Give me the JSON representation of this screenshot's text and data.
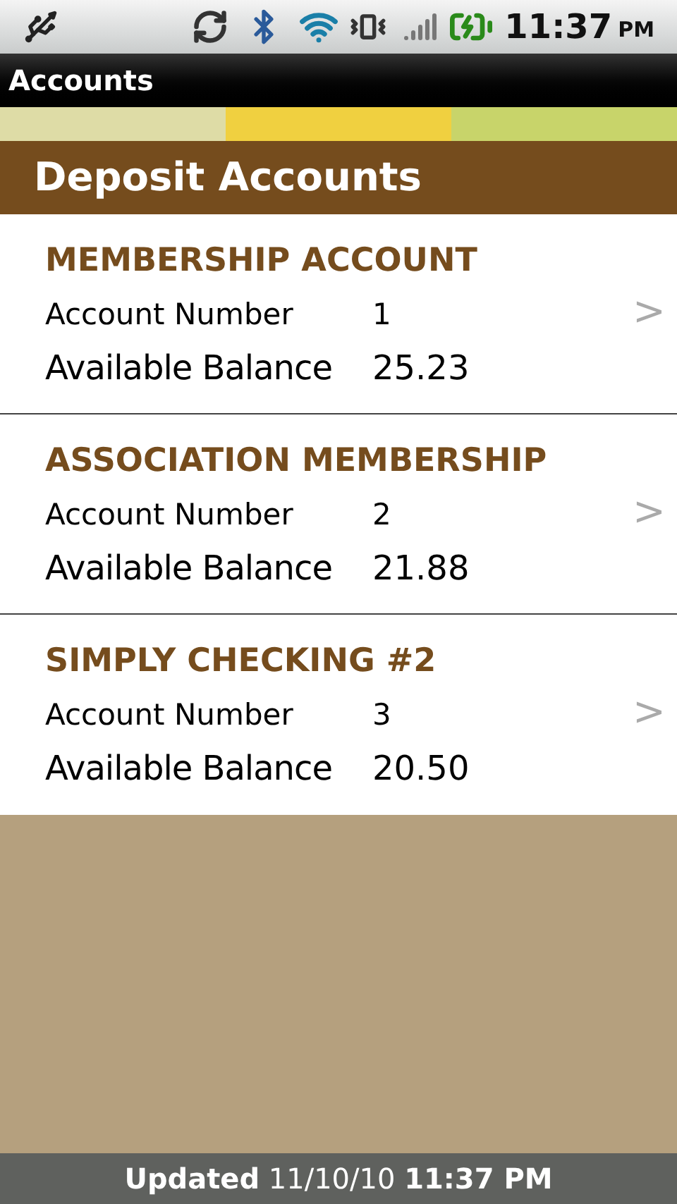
{
  "status_bar": {
    "time": "11:37",
    "period": "PM"
  },
  "title_bar": {
    "title": "Accounts"
  },
  "section": {
    "title": "Deposit Accounts"
  },
  "accounts": [
    {
      "name": "MEMBERSHIP ACCOUNT",
      "number_label": "Account Number",
      "number": "1",
      "balance_label": "Available Balance",
      "balance": "25.23",
      "chevron": ">"
    },
    {
      "name": "ASSOCIATION MEMBERSHIP",
      "number_label": "Account Number",
      "number": "2",
      "balance_label": "Available Balance",
      "balance": "21.88",
      "chevron": ">"
    },
    {
      "name": "SIMPLY CHECKING #2",
      "number_label": "Account Number",
      "number": "3",
      "balance_label": "Available Balance",
      "balance": "20.50",
      "chevron": ">"
    }
  ],
  "footer": {
    "text": "**Updated** 11/10/10 **11:37 PM**"
  }
}
